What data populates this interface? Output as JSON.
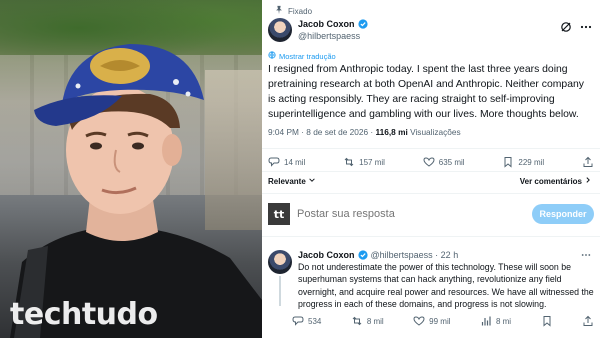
{
  "photo": {
    "watermark": "techtudo"
  },
  "post": {
    "pinned_label": "Fixado",
    "author_name": "Jacob Coxon",
    "author_handle": "@hilbertspaess",
    "translate_label": "Mostrar tradução",
    "text": "I resigned from Anthropic today. I spent the last three years doing pretraining research at both OpenAI and Anthropic. Neither company is acting responsibly. They are racing straight to self-improving superintelligence and gambling with our lives. More thoughts below.",
    "time": "9:04 PM · 8 de set de 2026 · ",
    "views_count": "116,8 mi",
    "views_label": " Visualizações",
    "stats": {
      "replies": "14 mil",
      "reposts": "157 mil",
      "likes": "635 mil",
      "bookmarks": "229 mil"
    }
  },
  "sort": {
    "relevant_label": "Relevante",
    "quotes_label": "Ver comentários"
  },
  "compose": {
    "avatar_text": "tt",
    "placeholder": "Postar sua resposta",
    "reply_button": "Responder"
  },
  "reply": {
    "author_name": "Jacob Coxon",
    "author_handle": "@hilbertspaess · 22 h",
    "text": "Do not underestimate the power of this technology. These will soon be superhuman systems that can hack anything, revolutionize any field overnight, and acquire real power and resources. We have all witnessed the progress in each of these domains, and progress is not slowing.",
    "stats": {
      "replies": "534",
      "reposts": "8 mil",
      "likes": "99 mil",
      "views": "8 mi"
    }
  },
  "colors": {
    "accent": "#1d9bf0",
    "muted": "#536471",
    "reply_button_bg": "#8ecdf8"
  }
}
